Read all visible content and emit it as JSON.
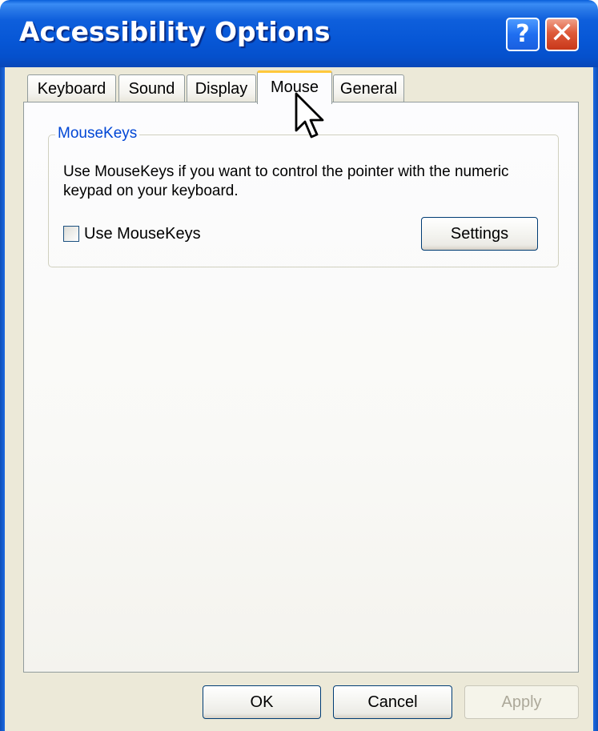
{
  "window": {
    "title": "Accessibility Options",
    "help_label": "?",
    "close_label": "✕"
  },
  "tabs": [
    {
      "label": "Keyboard",
      "active": false
    },
    {
      "label": "Sound",
      "active": false
    },
    {
      "label": "Display",
      "active": false
    },
    {
      "label": "Mouse",
      "active": true
    },
    {
      "label": "General",
      "active": false
    }
  ],
  "mousekeys": {
    "group_title": "MouseKeys",
    "description": "Use MouseKeys if you want to control the pointer with the numeric keypad on your keyboard.",
    "checkbox_label": "Use MouseKeys",
    "checked": false,
    "settings_label": "Settings"
  },
  "footer": {
    "ok_label": "OK",
    "cancel_label": "Cancel",
    "apply_label": "Apply",
    "apply_enabled": false
  },
  "colors": {
    "titlebar": "#0550cc",
    "group_title": "#0046d5",
    "active_tab_accent": "#ffc83c",
    "dialog_face": "#ece9d8"
  },
  "icons": {
    "help": "question-mark-icon",
    "close": "close-icon",
    "cursor": "mouse-pointer-icon"
  }
}
